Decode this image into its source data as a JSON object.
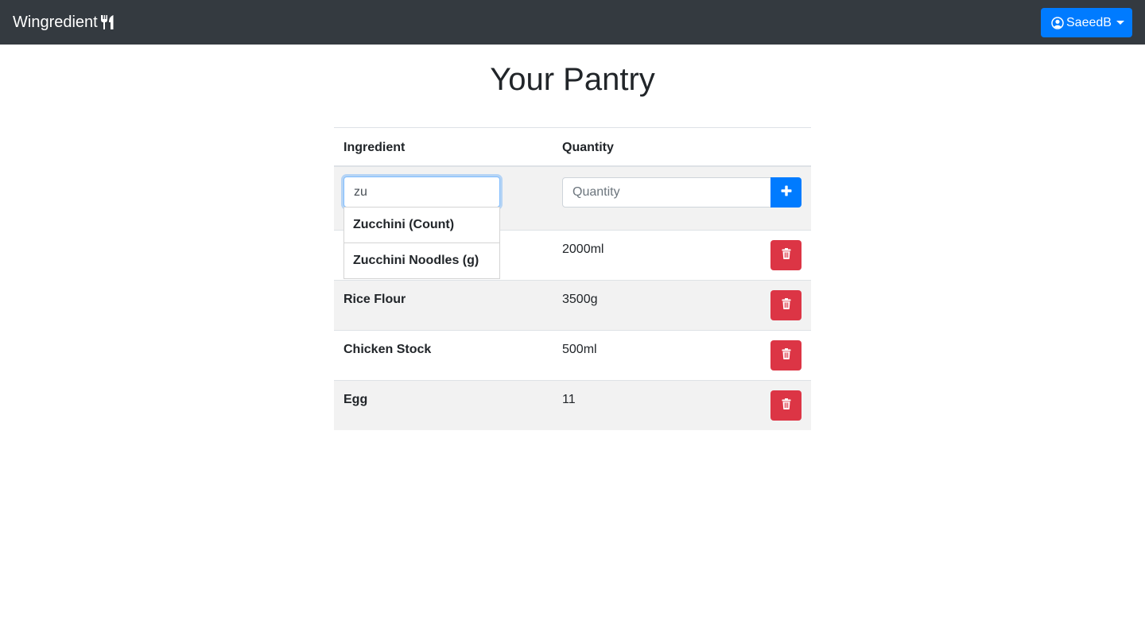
{
  "navbar": {
    "brand": "Wingredient",
    "brand_icon": "utensils-icon",
    "user_label": "SaeedB",
    "user_icon": "user-circle-icon"
  },
  "page": {
    "title": "Your Pantry"
  },
  "table": {
    "headers": {
      "ingredient": "Ingredient",
      "quantity": "Quantity"
    },
    "add_row": {
      "ingredient_value": "zu",
      "quantity_placeholder": "Quantity",
      "add_icon": "plus-icon"
    },
    "rows": [
      {
        "name": "",
        "quantity": "2000ml"
      },
      {
        "name": "Rice Flour",
        "quantity": "3500g"
      },
      {
        "name": "Chicken Stock",
        "quantity": "500ml"
      },
      {
        "name": "Egg",
        "quantity": "11"
      }
    ],
    "delete_icon": "trash-icon"
  },
  "autocomplete": {
    "suggestions": [
      "Zucchini (Count)",
      "Zucchini Noodles (g)"
    ]
  },
  "colors": {
    "navbar": "#343a40",
    "primary": "#007bff",
    "danger": "#dc3545",
    "stripe": "#f2f2f2"
  }
}
